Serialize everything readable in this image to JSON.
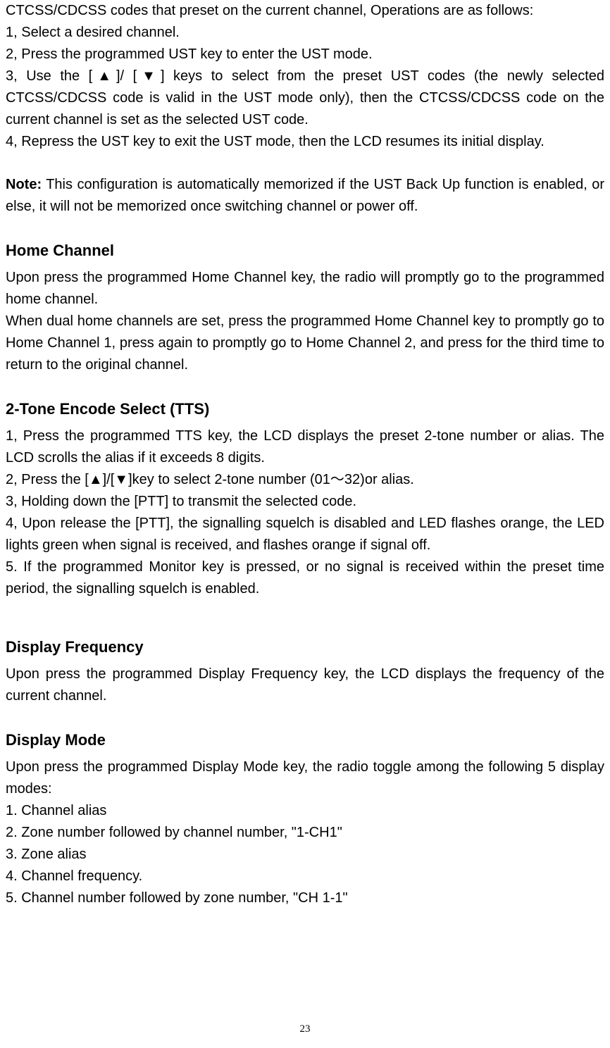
{
  "intro": {
    "line0": "CTCSS/CDCSS codes that preset on the current channel, Operations are as follows:",
    "step1": "1, Select a desired channel.",
    "step2": "2, Press the programmed UST key to enter the UST mode.",
    "step3": "3, Use the [▲]/ [▼] keys to select from the preset UST codes (the newly selected CTCSS/CDCSS code is valid in the UST mode only), then the CTCSS/CDCSS code on the current channel is set as the selected UST code.",
    "step4": "4, Repress the UST key to exit the UST mode, then the LCD resumes its initial display."
  },
  "note": {
    "label": "Note:",
    "text": " This configuration is automatically memorized if the UST Back Up function is enabled, or else, it will not be memorized once switching channel or power off."
  },
  "home_channel": {
    "heading": "Home Channel",
    "p1": "Upon press the programmed Home Channel key, the radio will promptly go to the programmed home channel.",
    "p2": "When dual home channels are set, press the programmed Home Channel key to promptly go to Home Channel 1, press again to promptly go to Home Channel 2, and press for the third time to return to the original channel."
  },
  "tts": {
    "heading": "2-Tone Encode Select (TTS)",
    "s1": "1, Press the programmed TTS key, the LCD displays the preset 2-tone number or alias. The LCD scrolls the alias if it exceeds 8 digits.",
    "s2": "2, Press the [▲]/[▼]key to select 2-tone number (01～32)or alias.",
    "s3": "3, Holding down the [PTT] to transmit the selected code.",
    "s4": "4, Upon release the [PTT], the signalling squelch is disabled and LED flashes orange, the LED lights green when signal is received, and flashes orange if signal off.",
    "s5": "5. If the programmed Monitor key is pressed, or no signal is received within the preset time period, the signalling squelch is enabled."
  },
  "display_frequency": {
    "heading": "Display Frequency",
    "p1": "Upon press the programmed Display Frequency key, the LCD displays the frequency of the current channel."
  },
  "display_mode": {
    "heading": "Display Mode",
    "intro": "Upon press the programmed Display Mode key, the radio toggle among the following 5 display modes:",
    "m1": "1. Channel alias",
    "m2": "2. Zone number followed by channel number, \"1-CH1\"",
    "m3": "3. Zone alias",
    "m4": "4. Channel frequency.",
    "m5": "5. Channel number followed by zone number, \"CH 1-1\""
  },
  "page_number": "23"
}
